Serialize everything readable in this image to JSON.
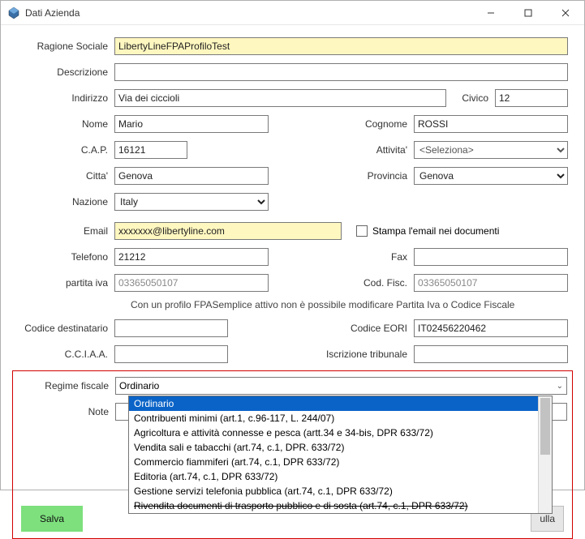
{
  "window": {
    "title": "Dati Azienda"
  },
  "labels": {
    "ragione_sociale": "Ragione Sociale",
    "descrizione": "Descrizione",
    "indirizzo": "Indirizzo",
    "civico": "Civico",
    "nome": "Nome",
    "cognome": "Cognome",
    "cap": "C.A.P.",
    "attivita": "Attivita'",
    "citta": "Citta'",
    "provincia": "Provincia",
    "nazione": "Nazione",
    "email": "Email",
    "stampa_email": "Stampa l'email nei documenti",
    "telefono": "Telefono",
    "fax": "Fax",
    "partita_iva": "partita iva",
    "cod_fisc": "Cod. Fisc.",
    "codice_destinatario": "Codice destinatario",
    "codice_eori": "Codice EORI",
    "cciaa": "C.C.I.A.A.",
    "iscrizione_tribunale": "Iscrizione tribunale",
    "regime_fiscale": "Regime fiscale",
    "note": "Note"
  },
  "fields": {
    "ragione_sociale": "LibertyLineFPAProfiloTest",
    "descrizione": "",
    "indirizzo": "Via dei ciccioli",
    "civico": "12",
    "nome": "Mario",
    "cognome": "ROSSI",
    "cap": "16121",
    "attivita_placeholder": "<Seleziona>",
    "citta": "Genova",
    "provincia": "Genova",
    "nazione": "Italy",
    "email": "xxxxxxx@libertyline.com",
    "telefono": "21212",
    "fax": "",
    "partita_iva": "03365050107",
    "cod_fisc": "03365050107",
    "codice_destinatario": "",
    "codice_eori": "IT02456220462",
    "cciaa": "",
    "iscrizione_tribunale": "",
    "regime_fiscale_selected": "Ordinario",
    "note": ""
  },
  "info_text": "Con un profilo FPASemplice attivo non è possibile modificare Partita Iva o Codice Fiscale",
  "regime_options": [
    {
      "label": "Ordinario",
      "selected": true
    },
    {
      "label": "Contribuenti minimi (art.1, c.96-117, L. 244/07)"
    },
    {
      "label": "Agricoltura e attività connesse e pesca (artt.34 e 34-bis, DPR 633/72)"
    },
    {
      "label": "Vendita sali e tabacchi (art.74, c.1, DPR. 633/72)"
    },
    {
      "label": "Commercio fiammiferi (art.74, c.1, DPR 633/72)"
    },
    {
      "label": "Editoria (art.74, c.1, DPR 633/72)"
    },
    {
      "label": "Gestione servizi telefonia pubblica (art.74, c.1, DPR 633/72)"
    },
    {
      "label": "Rivendita documenti di trasporto pubblico e di sosta (art.74, c.1, DPR 633/72)",
      "strike": true
    }
  ],
  "buttons": {
    "save": "Salva",
    "cancel": "ulla"
  }
}
